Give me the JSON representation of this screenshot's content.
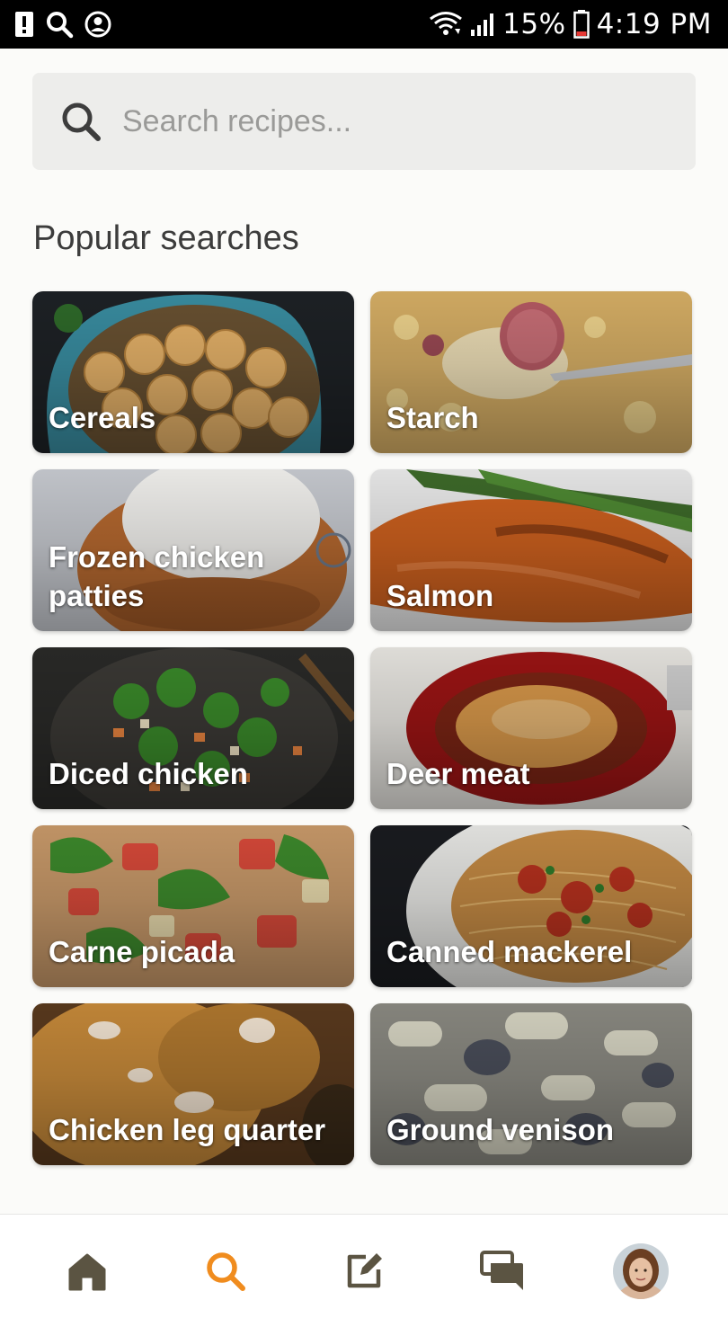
{
  "status_bar": {
    "battery": "15%",
    "time": "4:19 PM",
    "icons": [
      "alert-icon",
      "search-icon",
      "account-circle-icon",
      "wifi-icon",
      "signal-icon",
      "battery-low-icon"
    ]
  },
  "search": {
    "placeholder": "Search recipes..."
  },
  "popular": {
    "title": "Popular searches",
    "items": [
      {
        "label": "Cereals"
      },
      {
        "label": "Starch"
      },
      {
        "label": "Frozen chicken patties"
      },
      {
        "label": "Salmon"
      },
      {
        "label": "Diced chicken"
      },
      {
        "label": "Deer meat"
      },
      {
        "label": "Carne picada"
      },
      {
        "label": "Canned mackerel"
      },
      {
        "label": "Chicken leg quarter"
      },
      {
        "label": "Ground venison"
      }
    ]
  },
  "bottom_nav": {
    "items": [
      "home-icon",
      "search-icon",
      "edit-icon",
      "chat-icon",
      "avatar"
    ],
    "active": "search-icon",
    "active_color": "#f08c1e",
    "inactive_color": "#5b5442"
  }
}
